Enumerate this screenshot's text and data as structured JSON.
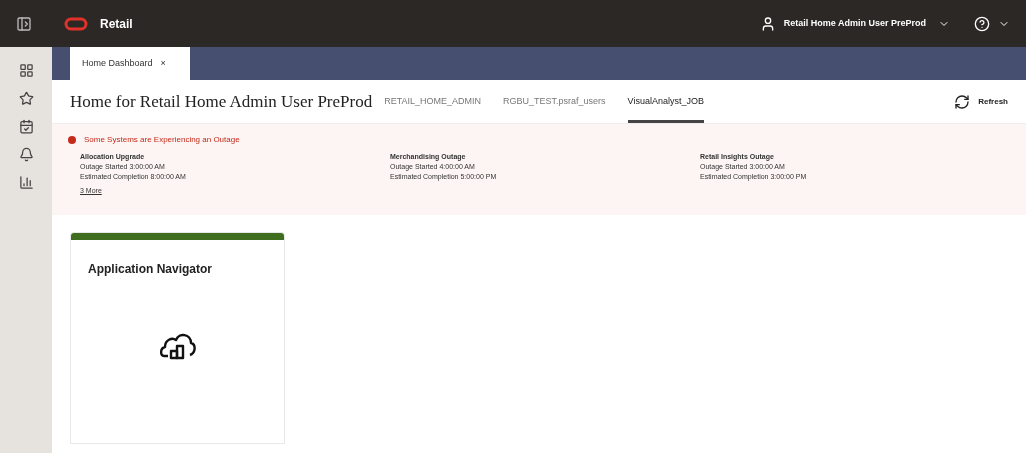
{
  "header": {
    "app_name": "Retail",
    "user_name": "Retail Home Admin User PreProd"
  },
  "open_tabs": [
    {
      "label": "Home Dashboard",
      "close": "×",
      "selected": true
    }
  ],
  "page": {
    "title": "Home for Retail Home Admin User PreProd",
    "refresh": "Refresh"
  },
  "dashboards": [
    {
      "label": "RETAIL_HOME_ADMIN",
      "selected": false
    },
    {
      "label": "RGBU_TEST.psraf_users",
      "selected": false
    },
    {
      "label": "VisualAnalyst_JOB",
      "selected": true
    }
  ],
  "alert": {
    "title": "Some Systems are Experiencing an Outage",
    "more": "3 More",
    "outages": [
      {
        "name": "Allocation Upgrade",
        "started": "Outage Started 3:00:00 AM",
        "completion": "Estimated Completion 8:00:00 AM"
      },
      {
        "name": "Merchandising Outage",
        "started": "Outage Started 4:00:00 AM",
        "completion": "Estimated Completion 5:00:00 PM"
      },
      {
        "name": "Retail Insights Outage",
        "started": "Outage Started 3:00:00 AM",
        "completion": "Estimated Completion 3:00:00 PM"
      }
    ]
  },
  "tiles": [
    {
      "title": "Application Navigator",
      "color": "#3f6e1e"
    }
  ]
}
